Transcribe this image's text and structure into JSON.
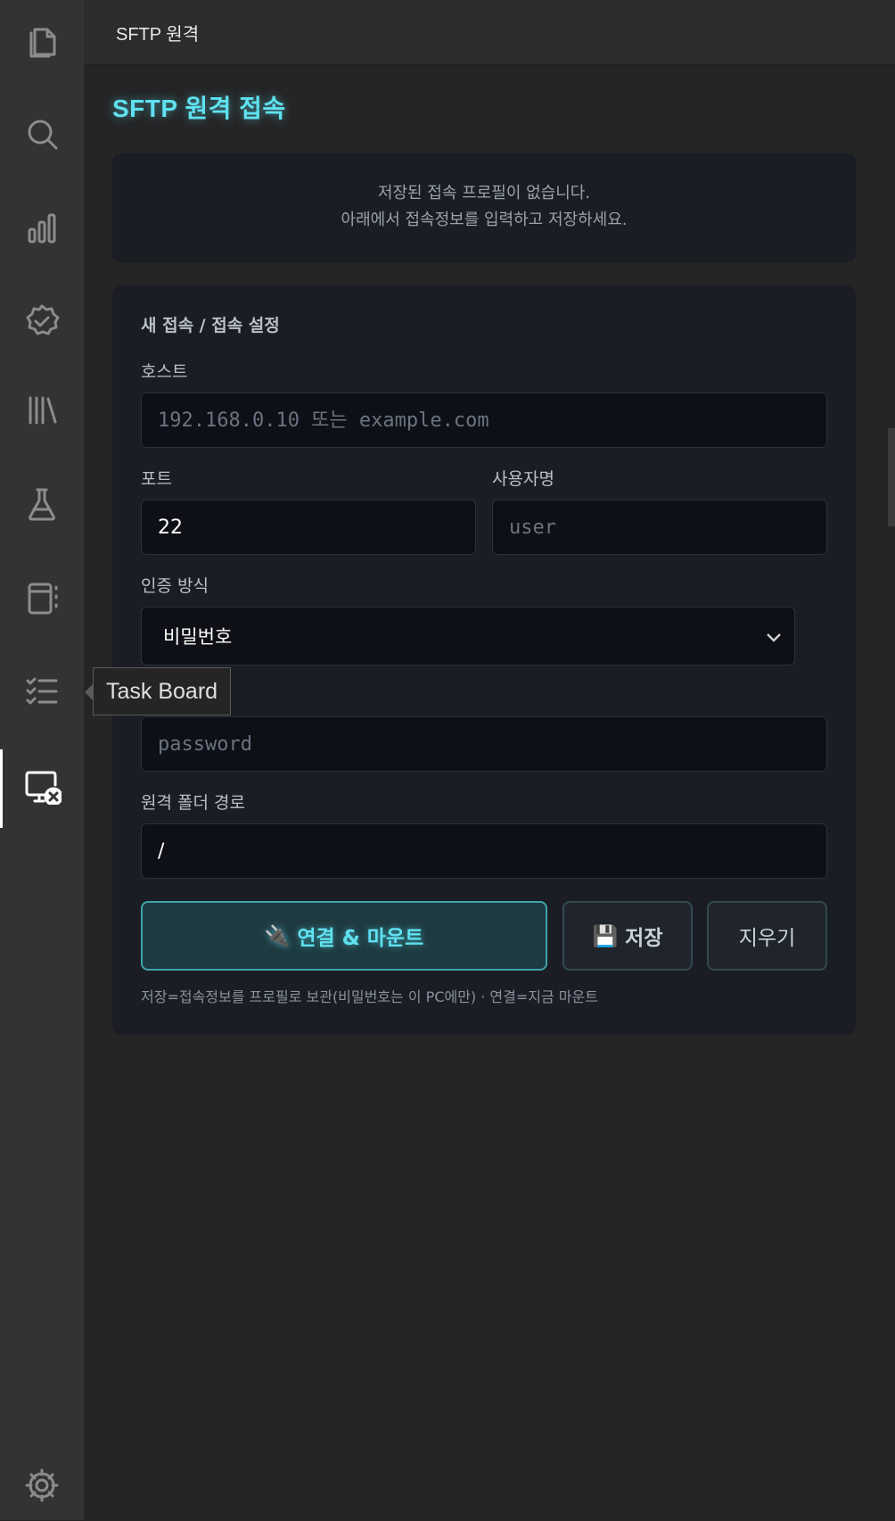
{
  "activity_bar": {
    "items": [
      {
        "name": "explorer-icon"
      },
      {
        "name": "search-icon"
      },
      {
        "name": "chart-icon"
      },
      {
        "name": "verified-icon"
      },
      {
        "name": "library-icon"
      },
      {
        "name": "flask-icon"
      },
      {
        "name": "notebook-icon"
      },
      {
        "name": "task-list-icon"
      },
      {
        "name": "remote-icon"
      },
      {
        "name": "settings-icon"
      }
    ],
    "tooltip": "Task Board"
  },
  "tab": {
    "title": "SFTP 원격"
  },
  "panel": {
    "title": "SFTP 원격 접속",
    "empty_line1": "저장된 접속 프로필이 없습니다.",
    "empty_line2": "아래에서 접속정보를 입력하고 저장하세요."
  },
  "form": {
    "section_title": "새 접속 / 접속 설정",
    "host": {
      "label": "호스트",
      "value": "",
      "placeholder": "192.168.0.10 또는 example.com"
    },
    "port": {
      "label": "포트",
      "value": "22",
      "placeholder": ""
    },
    "username": {
      "label": "사용자명",
      "value": "",
      "placeholder": "user"
    },
    "auth": {
      "label": "인증 방식",
      "selected": "비밀번호"
    },
    "password": {
      "value": "",
      "placeholder": "password"
    },
    "remote_path": {
      "label": "원격 폴더 경로",
      "value": "/"
    },
    "buttons": {
      "connect_icon": "🔌",
      "connect": "연결 & 마운트",
      "save_icon": "💾",
      "save": "저장",
      "clear": "지우기"
    },
    "hint": "저장=접속정보를 프로필로 보관(비밀번호는 이 PC에만) · 연결=지금 마운트"
  },
  "colors": {
    "accent": "#5fe1f0",
    "background": "#252526",
    "activity_bar": "#333333",
    "card": "#1a1d24"
  }
}
